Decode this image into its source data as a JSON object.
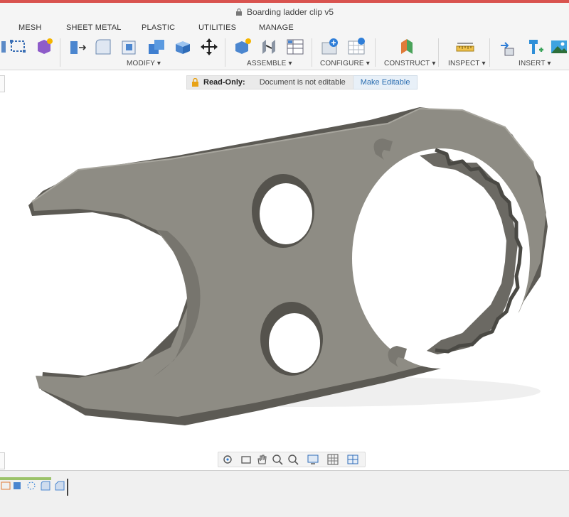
{
  "window": {
    "title": "Boarding ladder clip v5"
  },
  "tabs": [
    {
      "label": "MESH"
    },
    {
      "label": "SHEET METAL"
    },
    {
      "label": "PLASTIC"
    },
    {
      "label": "UTILITIES"
    },
    {
      "label": "MANAGE"
    }
  ],
  "toolbar": {
    "groups": [
      {
        "label": "MODIFY ▾"
      },
      {
        "label": "ASSEMBLE ▾"
      },
      {
        "label": "CONFIGURE ▾"
      },
      {
        "label": "CONSTRUCT ▾"
      },
      {
        "label": "INSPECT ▾"
      },
      {
        "label": "INSERT ▾"
      }
    ]
  },
  "banner": {
    "status": "Read-Only:",
    "message": "Document is not editable",
    "action": "Make Editable"
  },
  "colors": {
    "accent_red": "#d9534f",
    "part_gray": "#8e8c84",
    "link_blue": "#2a6db0"
  },
  "icons": {
    "title_lock": "lock-icon",
    "banner_lock": "lock-icon",
    "move": "move-arrows-icon",
    "orbit": "orbit-icon",
    "pan": "hand-icon",
    "zoom": "zoom-icon",
    "display": "display-settings-icon",
    "grid": "grid-icon",
    "viewports": "viewports-icon"
  }
}
